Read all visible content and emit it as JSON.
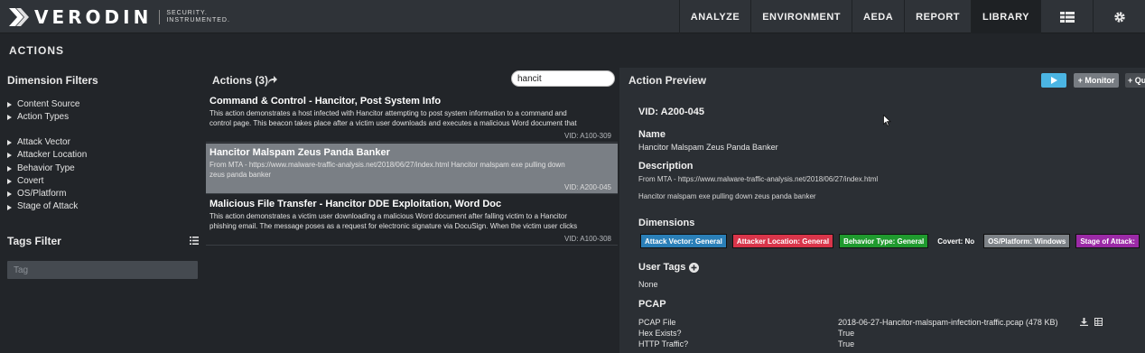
{
  "app": {
    "logo_word": "VERODIN",
    "logo_tagline_1": "SECURITY.",
    "logo_tagline_2": "INSTRUMENTED."
  },
  "nav": {
    "items": [
      "ANALYZE",
      "ENVIRONMENT",
      "AEDA",
      "REPORT",
      "LIBRARY"
    ],
    "active": "LIBRARY",
    "icons": [
      "grid-menu-icon",
      "gear-icon"
    ]
  },
  "page_title": "ACTIONS",
  "left": {
    "dimension_filters_title": "Dimension Filters",
    "group1": [
      "Content Source",
      "Action Types"
    ],
    "group2": [
      "Attack Vector",
      "Attacker Location",
      "Behavior Type",
      "Covert",
      "OS/Platform",
      "Stage of Attack"
    ],
    "tags_filter_title": "Tags Filter",
    "tag_placeholder": "Tag"
  },
  "actions": {
    "title": "Actions (3)",
    "search_value": "hancit",
    "results": [
      {
        "title": "Command & Control - Hancitor, Post System Info",
        "desc1": "This action demonstrates a host infected with Hancitor attempting to post system information to a command and",
        "desc2": "control page. This beacon takes place after a victim user downloads and executes a malicious Word document that",
        "vid": "VID: A100-309"
      },
      {
        "title": "Hancitor Malspam Zeus Panda Banker",
        "desc1": "From MTA - https://www.malware-traffic-analysis.net/2018/06/27/index.html Hancitor malspam exe pulling down",
        "desc2": "zeus panda banker",
        "vid": "VID: A200-045"
      },
      {
        "title": "Malicious File Transfer - Hancitor DDE Exploitation, Word Doc",
        "desc1": "This action demonstrates a victim user downloading a malicious Word document after falling victim to a Hancitor",
        "desc2": "phishing email. The message poses as a request for electronic signature via DocuSign. When the victim user clicks",
        "vid": "VID: A100-308"
      }
    ]
  },
  "preview": {
    "title": "Action Preview",
    "monitor_label": "+ Monitor",
    "queue_label": "+ Qu",
    "vid": "VID: A200-045",
    "name_label": "Name",
    "name": "Hancitor Malspam Zeus Panda Banker",
    "description_label": "Description",
    "description_1": "From MTA - https://www.malware-traffic-analysis.net/2018/06/27/index.html",
    "description_2": "Hancitor malspam exe pulling down zeus panda banker",
    "dimensions_label": "Dimensions",
    "dimensions": [
      {
        "text": "Attack Vector: General",
        "color": "#2a7fb8"
      },
      {
        "text": "Attacker Location: General",
        "color": "#d9354a"
      },
      {
        "text": "Behavior Type: General",
        "color": "#1f9a2e"
      },
      {
        "text": "Covert: No",
        "color": ""
      },
      {
        "text": "OS/Platform: Windows",
        "color": "#7d8287"
      },
      {
        "text": "Stage of Attack:",
        "color": "#9b2aa6"
      }
    ],
    "user_tags_label": "User Tags",
    "user_tags_value": "None",
    "pcap_label": "PCAP",
    "pcap_file_key": "PCAP File",
    "pcap_file_value": "2018-06-27-Hancitor-malspam-infection-traffic.pcap (478 KB)",
    "hex_key": "Hex Exists?",
    "hex_value": "True",
    "http_key": "HTTP Traffic?",
    "http_value": "True"
  }
}
